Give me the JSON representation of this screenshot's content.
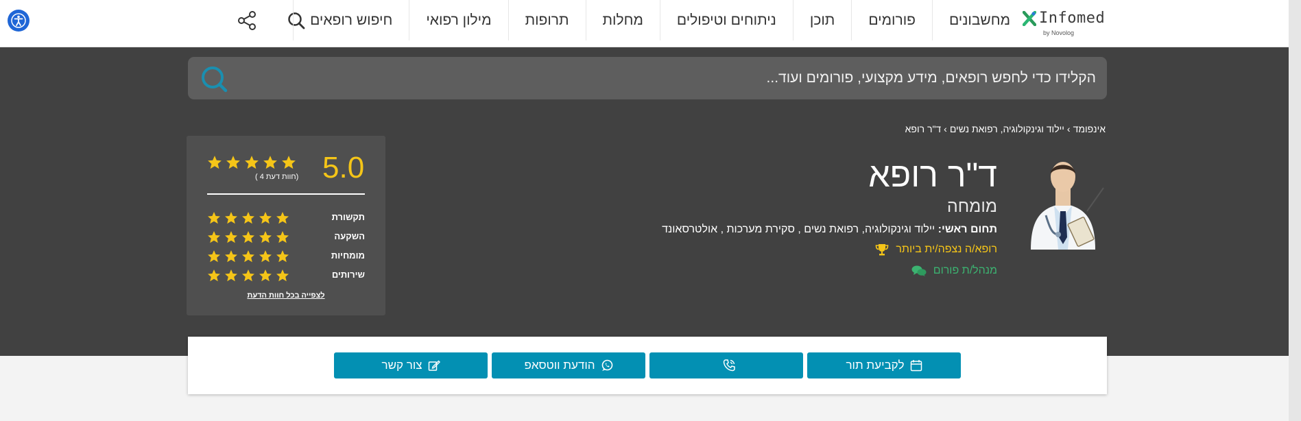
{
  "header": {
    "logo_text": "Infomed",
    "logo_sub": "by Novolog",
    "nav": [
      "חיפוש רופאים",
      "מילון רפואי",
      "תרופות",
      "מחלות",
      "ניתוחים וטיפולים",
      "תוכן",
      "פורומים",
      "מחשבונים"
    ],
    "icons": [
      "accessibility-icon",
      "search-icon",
      "share-icon"
    ]
  },
  "search": {
    "placeholder": "הקלידו כדי לחפש רופאים, מידע מקצועי, פורומים ועוד..."
  },
  "breadcrumb": [
    "אינפומד",
    "יילוד וגינקולוגיה, רפואת נשים",
    "ד\"ר רופא"
  ],
  "doctor": {
    "name": "ד\"ר רופא",
    "title": "מומחה",
    "field_label": "תחום ראשי:",
    "field_value": "יילוד וגינקולוגיה, רפואת נשים , סקירת מערכות , אולטרסאונד",
    "badge_top": "רופא/ה נצפה/ית ביותר",
    "badge_forum": "מנהל/ת פורום"
  },
  "rating": {
    "score": "5.0",
    "stars": 5,
    "reviews_label": "( 4 חוות דעת)",
    "categories": [
      {
        "label": "תקשורת",
        "stars": 5
      },
      {
        "label": "השקעה",
        "stars": 5
      },
      {
        "label": "מומחיות",
        "stars": 5
      },
      {
        "label": "שירותים",
        "stars": 5
      }
    ],
    "see_all": "לצפייה בכל חוות הדעת"
  },
  "actions": {
    "appointment": "לקביעת תור",
    "phone": "",
    "whatsapp": "הודעת ווטסאפ",
    "contact": "צור קשר"
  },
  "colors": {
    "band": "#414141",
    "accent": "#0390b3",
    "gold": "#f5c518",
    "green": "#3cb371",
    "search_icon": "#1a8fb0"
  }
}
